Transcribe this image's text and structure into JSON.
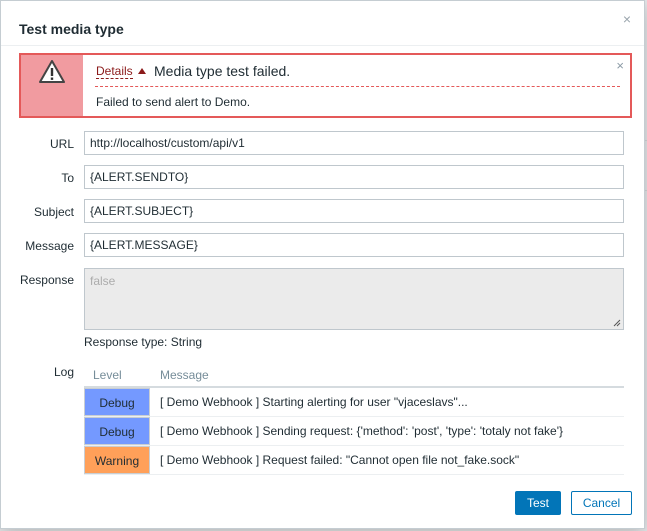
{
  "dialog": {
    "title": "Test media type",
    "close_glyph": "×"
  },
  "error": {
    "details_label": "Details",
    "summary": "Media type test failed.",
    "detail": "Failed to send alert to Demo.",
    "close_glyph": "×",
    "icon": "warning-icon",
    "colors": {
      "border": "#e45959",
      "icon_bg": "#f19ba0"
    }
  },
  "form": {
    "url": {
      "label": "URL",
      "value": "http://localhost/custom/api/v1"
    },
    "to": {
      "label": "To",
      "value": "{ALERT.SENDTO}"
    },
    "subject": {
      "label": "Subject",
      "value": "{ALERT.SUBJECT}"
    },
    "message": {
      "label": "Message",
      "value": "{ALERT.MESSAGE}"
    },
    "response": {
      "label": "Response",
      "placeholder": "false"
    },
    "response_type": "Response type: String"
  },
  "log": {
    "label": "Log",
    "columns": [
      "Level",
      "Message"
    ],
    "rows": [
      {
        "level": "Debug",
        "message": "[ Demo Webhook ] Starting alerting for user \"vjaceslavs\"...",
        "color": "#7499ff"
      },
      {
        "level": "Debug",
        "message": "[ Demo Webhook ] Sending request: {'method': 'post', 'type': 'totaly not fake'}",
        "color": "#7499ff"
      },
      {
        "level": "Warning",
        "message": "[ Demo Webhook ] Request failed: \"Cannot open file not_fake.sock\"",
        "color": "#ffa059"
      }
    ]
  },
  "footer": {
    "test_label": "Test",
    "cancel_label": "Cancel",
    "accent": "#0275b8"
  }
}
